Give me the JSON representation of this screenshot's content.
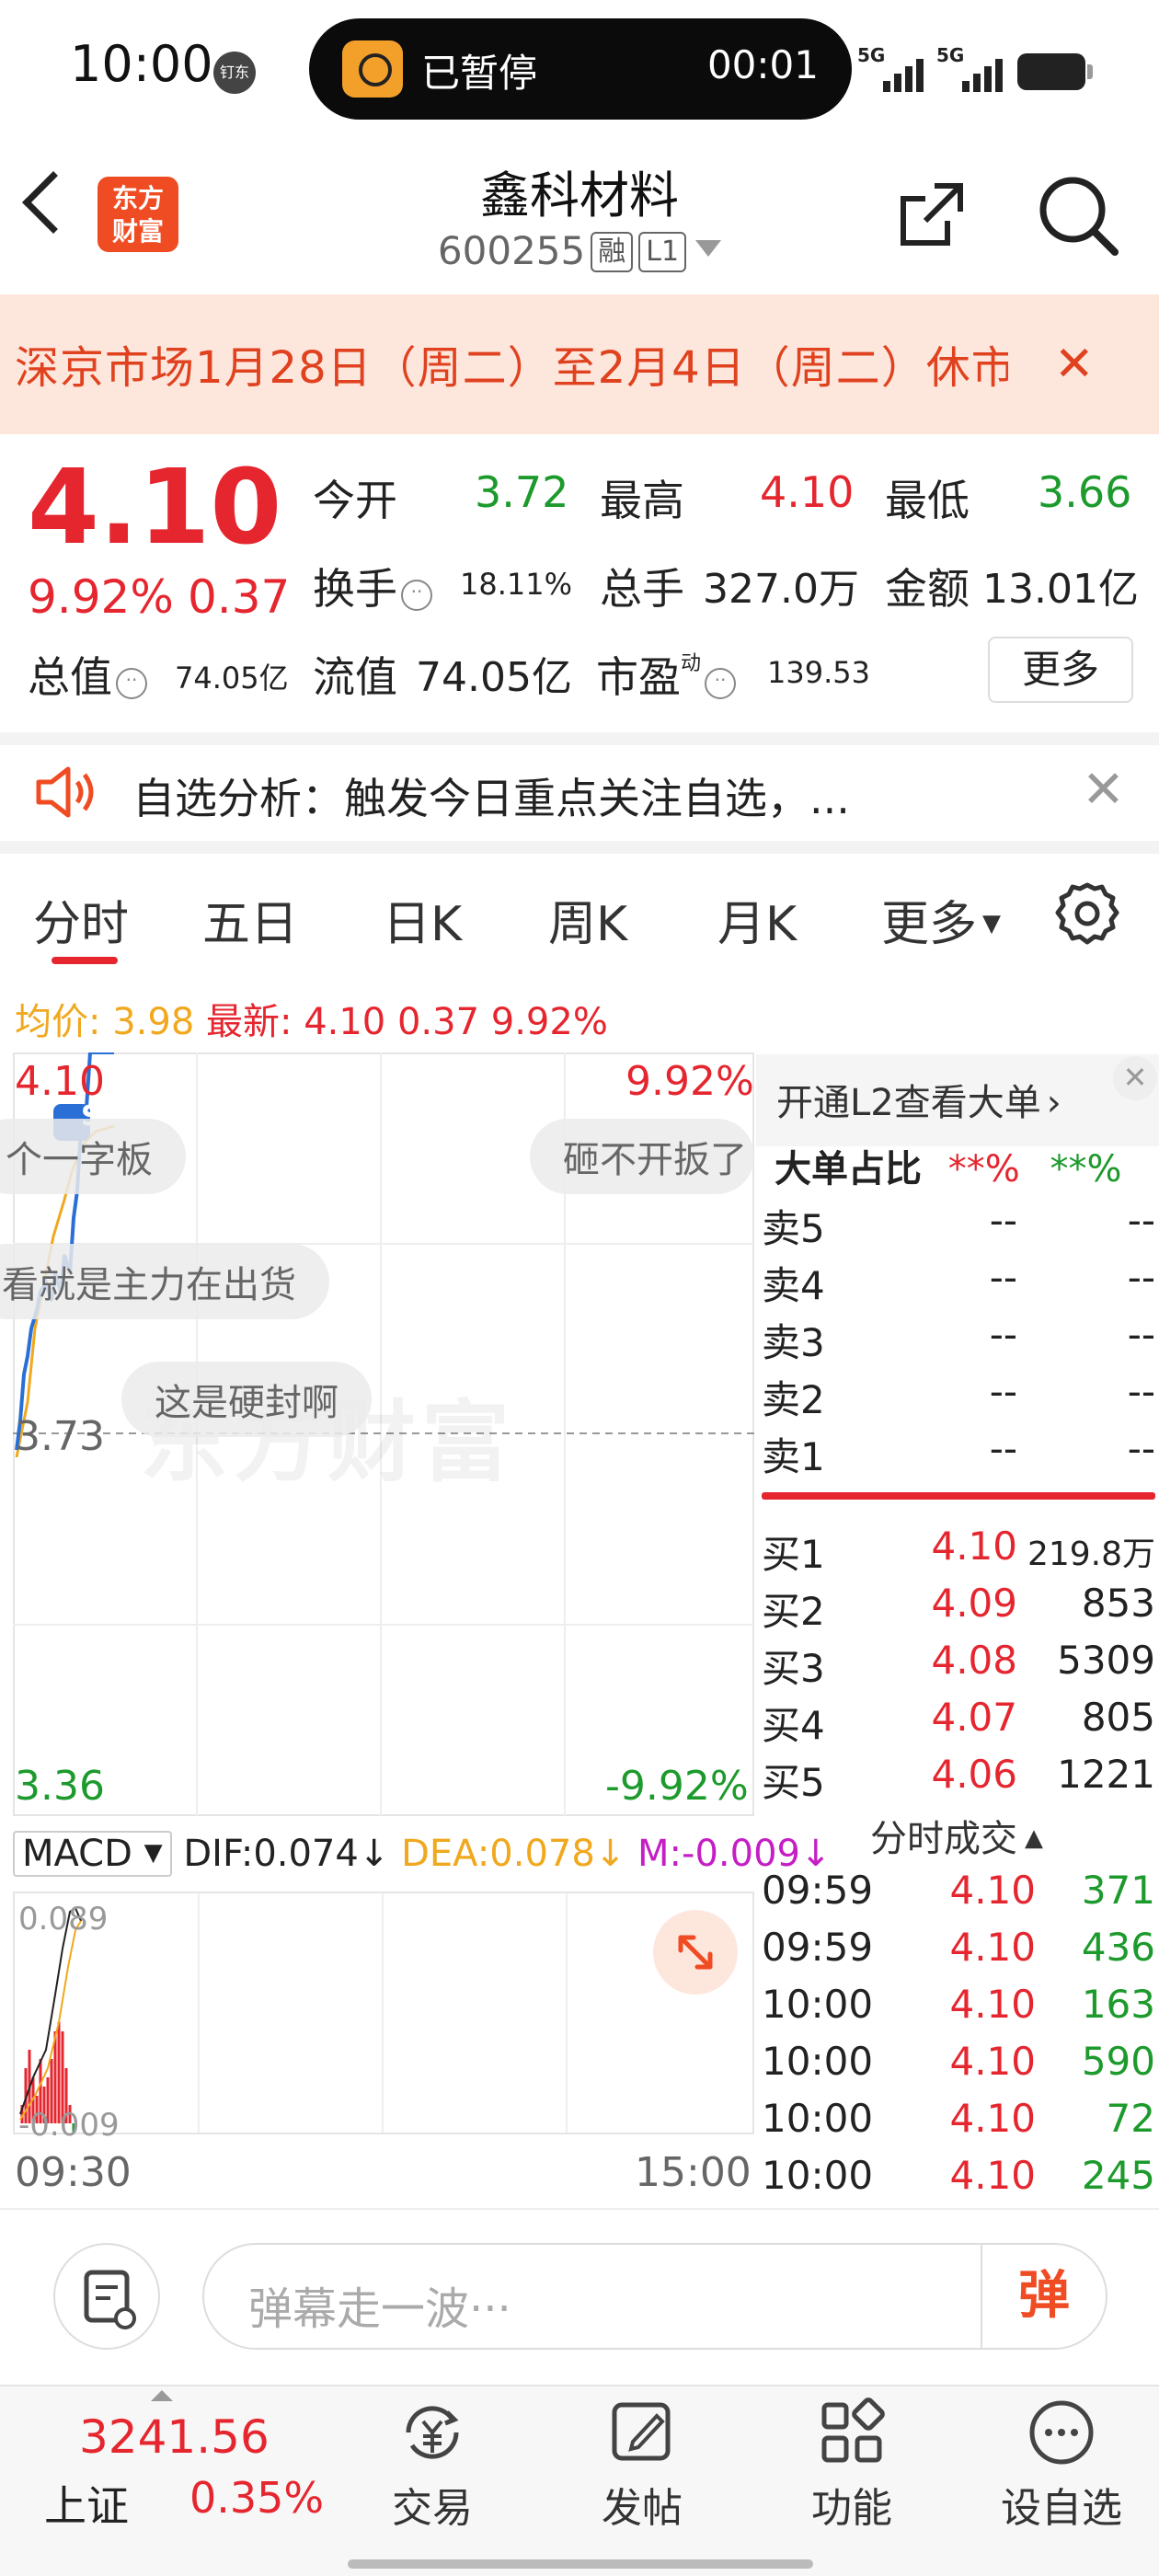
{
  "status_bar": {
    "time": "10:00",
    "ding_badge": "钉东",
    "timer_label": "已暂停",
    "timer_value": "00:01",
    "signal1": "5G",
    "signal2": "5G"
  },
  "header": {
    "logo_line1": "东方",
    "logo_line2": "财富",
    "stock_name": "鑫科材料",
    "stock_code": "600255",
    "tag_rong": "融",
    "tag_level": "L1"
  },
  "banner": {
    "text": "深京市场1月28日（周二）至2月4日（周二）休市"
  },
  "quote": {
    "price": "4.10",
    "change_pct": "9.92%",
    "change": "0.37",
    "open_label": "今开",
    "open": "3.72",
    "high_label": "最高",
    "high": "4.10",
    "low_label": "最低",
    "low": "3.66",
    "turnover_label": "换手",
    "turnover": "18.11%",
    "volume_label": "总手",
    "volume": "327.0万",
    "amount_label": "金额",
    "amount": "13.01亿",
    "mktcap_label": "总值",
    "mktcap": "74.05亿",
    "float_label": "流值",
    "float": "74.05亿",
    "pe_label": "市盈",
    "pe_sup": "动",
    "pe": "139.53",
    "more_label": "更多"
  },
  "analysis": {
    "text": "自选分析：触发今日重点关注自选，..."
  },
  "tabs": [
    {
      "label": "分时",
      "active": true
    },
    {
      "label": "五日"
    },
    {
      "label": "日K"
    },
    {
      "label": "周K"
    },
    {
      "label": "月K"
    },
    {
      "label": "更多"
    }
  ],
  "avg_row": {
    "avg_label": "均价:",
    "avg": "3.98",
    "latest_label": "最新:",
    "latest": "4.10",
    "change": "0.37",
    "pct": "9.92%"
  },
  "chart": {
    "top_price": "4.10",
    "top_pct": "9.92%",
    "mid_price": "3.73",
    "bottom_price": "3.36",
    "bottom_pct": "-9.92%",
    "marker": "S",
    "watermark": "东方财富",
    "danmu": [
      "个一字板",
      "砸不开扳了",
      "看就是主力在出货",
      "这是硬封啊"
    ],
    "colors": {
      "price": "#2a6fd6",
      "avg": "#f0a81e",
      "up": "#e5262f",
      "down": "#1d9a2c"
    }
  },
  "macd": {
    "select": "MACD",
    "dif": "DIF:0.074↓",
    "dea": "DEA:0.078↓",
    "m": "M:-0.009↓",
    "top_label": "0.089",
    "bottom_label": "-0.009",
    "time_start": "09:30",
    "time_end": "15:00"
  },
  "order_book": {
    "l2_link": "开通L2查看大单",
    "big_order_label": "大单占比",
    "big_order_red": "**%",
    "big_order_green": "**%",
    "asks": [
      {
        "label": "卖5",
        "price": "--",
        "vol": "--"
      },
      {
        "label": "卖4",
        "price": "--",
        "vol": "--"
      },
      {
        "label": "卖3",
        "price": "--",
        "vol": "--"
      },
      {
        "label": "卖2",
        "price": "--",
        "vol": "--"
      },
      {
        "label": "卖1",
        "price": "--",
        "vol": "--"
      }
    ],
    "bids": [
      {
        "label": "买1",
        "price": "4.10",
        "vol": "219.8万"
      },
      {
        "label": "买2",
        "price": "4.09",
        "vol": "853"
      },
      {
        "label": "买3",
        "price": "4.08",
        "vol": "5309"
      },
      {
        "label": "买4",
        "price": "4.07",
        "vol": "805"
      },
      {
        "label": "买5",
        "price": "4.06",
        "vol": "1221"
      }
    ],
    "ticks_title": "分时成交",
    "ticks": [
      {
        "time": "09:59",
        "price": "4.10",
        "vol": "371",
        "dir": "down"
      },
      {
        "time": "09:59",
        "price": "4.10",
        "vol": "436",
        "dir": "down"
      },
      {
        "time": "10:00",
        "price": "4.10",
        "vol": "163",
        "dir": "down"
      },
      {
        "time": "10:00",
        "price": "4.10",
        "vol": "590",
        "dir": "down"
      },
      {
        "time": "10:00",
        "price": "4.10",
        "vol": "72",
        "dir": "down"
      },
      {
        "time": "10:00",
        "price": "4.10",
        "vol": "245",
        "dir": "down"
      }
    ]
  },
  "comment_bar": {
    "placeholder": "弹幕走一波···",
    "send_label": "弹"
  },
  "bottom_nav": {
    "index_value": "3241.56",
    "index_name": "上证",
    "index_pct": "0.35%",
    "items": [
      {
        "label": "交易",
        "icon": "yuan-exchange-icon"
      },
      {
        "label": "发帖",
        "icon": "edit-icon"
      },
      {
        "label": "功能",
        "icon": "grid-icon"
      },
      {
        "label": "设自选",
        "icon": "more-dots-icon"
      }
    ]
  }
}
